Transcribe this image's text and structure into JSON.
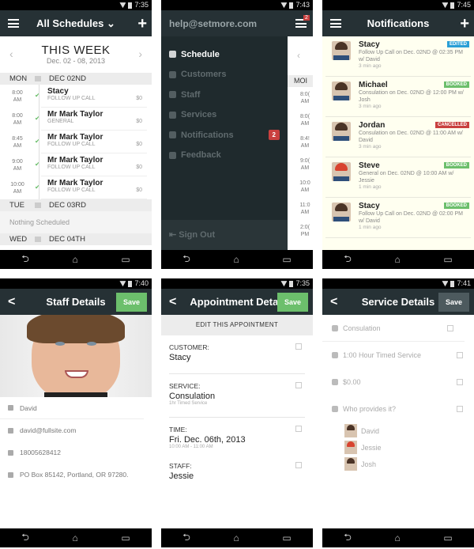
{
  "schedule": {
    "time": "7:35",
    "title": "All Schedules ⌄",
    "week_title": "THIS WEEK",
    "week_range": "Dec. 02 - 08, 2013",
    "days": [
      {
        "dow": "MON",
        "date": "DEC 02ND"
      },
      {
        "dow": "TUE",
        "date": "DEC 03RD"
      },
      {
        "dow": "WED",
        "date": "DEC 04TH"
      }
    ],
    "appointments": [
      {
        "time": "8:00",
        "ampm": "AM",
        "name": "Stacy",
        "service": "FOLLOW UP CALL",
        "price": "$0"
      },
      {
        "time": "8:00",
        "ampm": "AM",
        "name": "Mr Mark Taylor",
        "service": "GENERAL",
        "price": "$0"
      },
      {
        "time": "8:45",
        "ampm": "AM",
        "name": "Mr Mark Taylor",
        "service": "FOLLOW UP CALL",
        "price": "$0"
      },
      {
        "time": "9:00",
        "ampm": "AM",
        "name": "Mr Mark Taylor",
        "service": "FOLLOW UP CALL",
        "price": "$0"
      },
      {
        "time": "10:00",
        "ampm": "AM",
        "name": "Mr Mark Taylor",
        "service": "FOLLOW UP CALL",
        "price": "$0"
      }
    ],
    "nothing_scheduled": "Nothing Scheduled"
  },
  "drawer": {
    "time": "7:43",
    "email": "help@setmore.com",
    "items": [
      {
        "label": "Schedule"
      },
      {
        "label": "Customers"
      },
      {
        "label": "Staff"
      },
      {
        "label": "Services"
      },
      {
        "label": "Notifications",
        "badge": "2"
      },
      {
        "label": "Feedback"
      }
    ],
    "sign_out": "Sign Out",
    "menu_badge": "2",
    "peek_day": "MOI",
    "peek_times": [
      "8:0( AM",
      "8:0( AM",
      "8:4! AM",
      "9:0( AM",
      "10:0 AM",
      "11:0 AM",
      "2:0( PM"
    ]
  },
  "notifications": {
    "time": "7:45",
    "title": "Notifications",
    "colors": {
      "edited": "#2a9fd6",
      "booked": "#6cbf6c",
      "cancelled": "#c9403f"
    },
    "items": [
      {
        "name": "Stacy",
        "desc": "Follow Up Call on Dec. 02ND @ 02:35 PM w/ David",
        "ago": "3 min ago",
        "status": "EDITED",
        "kind": "edited"
      },
      {
        "name": "Michael",
        "desc": "Consulation on Dec. 02ND @ 12:00 PM w/ Josh",
        "ago": "3 min ago",
        "status": "BOOKED",
        "kind": "booked"
      },
      {
        "name": "Jordan",
        "desc": "Consulation on Dec. 02ND @ 11:00 AM w/ David",
        "ago": "3 min ago",
        "status": "CANCELLED",
        "kind": "cancelled"
      },
      {
        "name": "Steve",
        "desc": "General on Dec. 02ND @ 10:00 AM w/ Jessie",
        "ago": "1 min ago",
        "status": "BOOKED",
        "kind": "booked"
      },
      {
        "name": "Stacy",
        "desc": "Follow Up Call on Dec. 02ND @ 02:00 PM w/ David",
        "ago": "1 min ago",
        "status": "BOOKED",
        "kind": "booked"
      }
    ]
  },
  "staff": {
    "time": "7:40",
    "title": "Staff Details",
    "save": "Save",
    "name": "David",
    "email": "david@fullsite.com",
    "phone": "18005628412",
    "address": "PO Box 85142, Portland, OR 97280."
  },
  "appointment": {
    "time": "7:35",
    "title": "Appointment Detail",
    "save": "Save",
    "edit_label": "EDIT THIS APPOINTMENT",
    "customer_label": "CUSTOMER:",
    "customer": "Stacy",
    "service_label": "SERVICE:",
    "service": "Consulation",
    "service_sub": "1hr Timed Service",
    "time_label": "TIME:",
    "date": "Fri. Dec. 06th, 2013",
    "time_range": "10:00 AM - 11:00 AM",
    "staff_label": "STAFF:",
    "staff": "Jessie"
  },
  "service": {
    "time": "7:41",
    "title": "Service Details",
    "save": "Save",
    "name": "Consulation",
    "duration": "1:00 Hour Timed Service",
    "price": "$0.00",
    "providers_label": "Who provides it?",
    "providers": [
      "David",
      "Jessie",
      "Josh"
    ]
  },
  "nav": {
    "back": "⮌",
    "home": "⌂",
    "recents": "▭"
  }
}
